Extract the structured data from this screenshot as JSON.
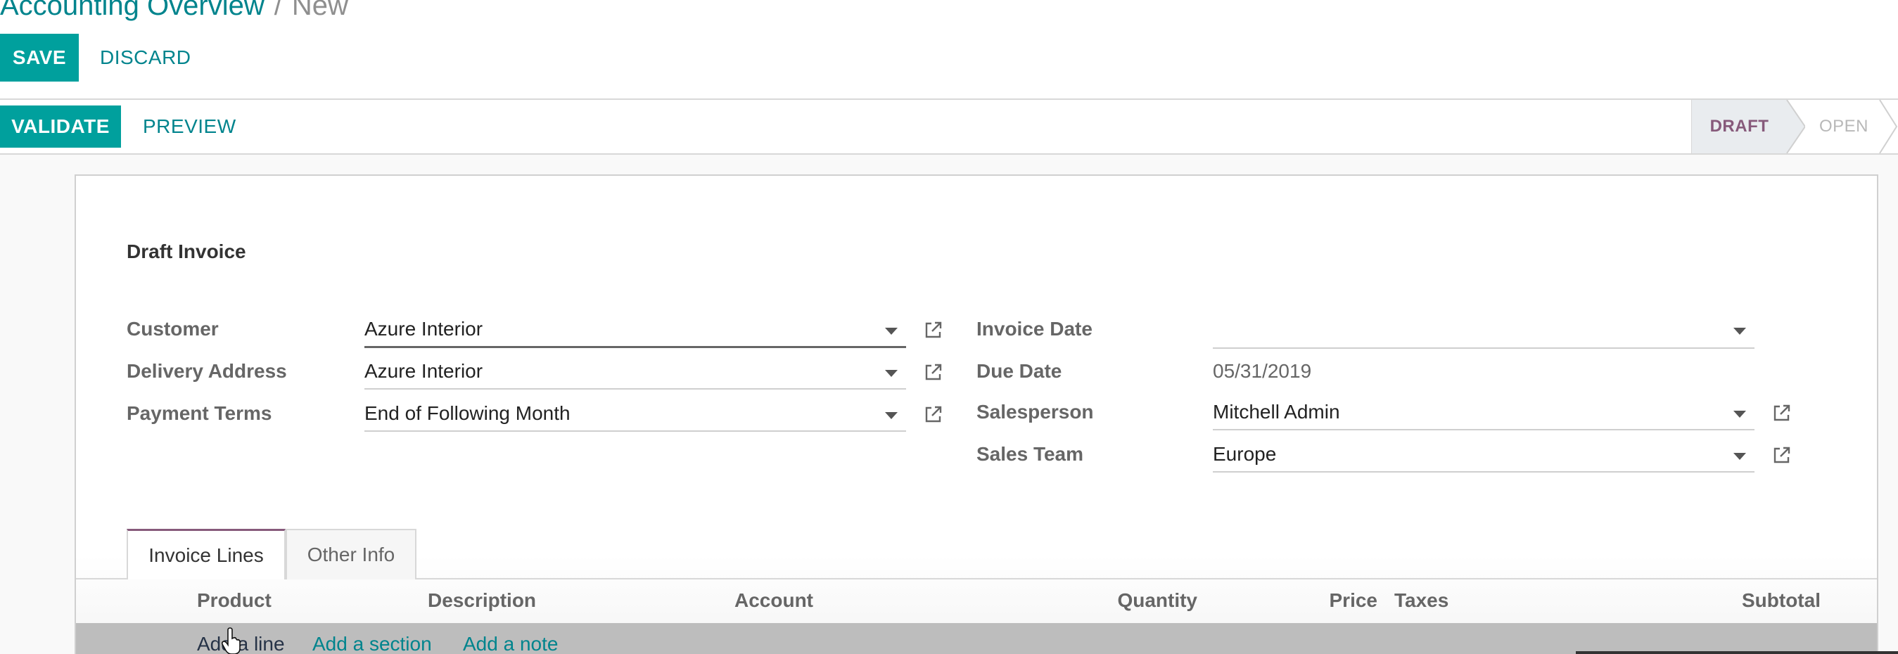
{
  "breadcrumb": {
    "parent": "Accounting Overview",
    "separator": "/",
    "current": "New"
  },
  "toolbar": {
    "save_label": "SAVE",
    "discard_label": "DISCARD"
  },
  "actions": {
    "validate_label": "VALIDATE",
    "preview_label": "PREVIEW"
  },
  "status": {
    "stages": [
      "DRAFT",
      "OPEN"
    ],
    "current": "DRAFT"
  },
  "form": {
    "title": "Draft Invoice",
    "left_fields": [
      {
        "label": "Customer",
        "value": "Azure Interior"
      },
      {
        "label": "Delivery Address",
        "value": "Azure Interior"
      },
      {
        "label": "Payment Terms",
        "value": "End of Following Month"
      }
    ],
    "right_fields": [
      {
        "label": "Invoice Date",
        "value": ""
      },
      {
        "label": "Due Date",
        "value": "05/31/2019"
      },
      {
        "label": "Salesperson",
        "value": "Mitchell Admin"
      },
      {
        "label": "Sales Team",
        "value": "Europe"
      }
    ]
  },
  "tabs": [
    {
      "label": "Invoice Lines",
      "active": true
    },
    {
      "label": "Other Info",
      "active": false
    }
  ],
  "table": {
    "columns": [
      "Product",
      "Description",
      "Account",
      "Quantity",
      "Price",
      "Taxes",
      "Subtotal"
    ],
    "add_links": [
      "Add a line",
      "Add a section",
      "Add a note"
    ]
  },
  "colors": {
    "primary": "#00a09d",
    "link": "#00848d",
    "brand": "#875a7b"
  },
  "icons": {
    "external_link": "external-link-icon",
    "dropdown": "chevron-down-icon",
    "cursor": "hand-pointer-icon"
  }
}
